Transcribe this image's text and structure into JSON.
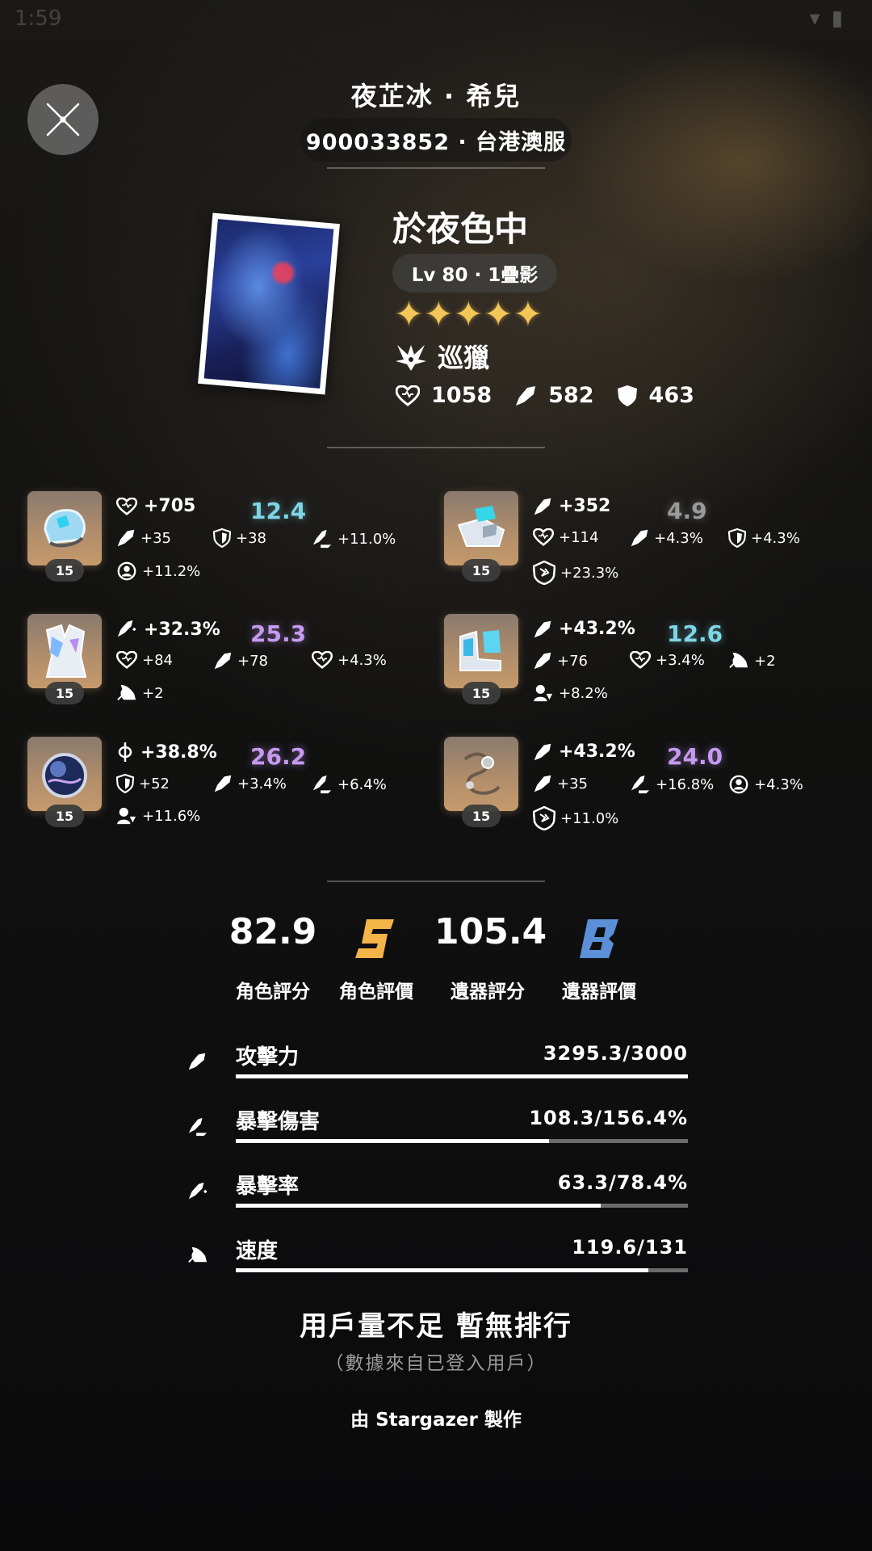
{
  "status_bar": {
    "time": "1:59"
  },
  "header": {
    "player_name": "夜芷冰 · 希兒",
    "uid_server": "900033852 · 台港澳服"
  },
  "light_cone": {
    "name": "於夜色中",
    "level": "Lv 80 · 1疊影",
    "stars": "✦✦✦✦✦",
    "rarity": 5,
    "path": "巡獵",
    "hp": "1058",
    "atk": "582",
    "def": "463"
  },
  "relics": [
    {
      "slot": "head",
      "level": "15",
      "main": {
        "icon": "hp-icon",
        "value": "+705"
      },
      "score": "12.4",
      "score_color": "#7fd6e6",
      "subs": [
        {
          "icon": "atk-icon",
          "value": "+35"
        },
        {
          "icon": "def-icon",
          "value": "+38"
        },
        {
          "icon": "crit-dmg-icon",
          "value": "+11.0%"
        },
        {
          "icon": "effect-res-icon",
          "value": "+11.2%"
        }
      ]
    },
    {
      "slot": "hands",
      "level": "15",
      "main": {
        "icon": "atk-icon",
        "value": "+352"
      },
      "score": "4.9",
      "score_color": "#9a9a9a",
      "subs": [
        {
          "icon": "hp-icon",
          "value": "+114"
        },
        {
          "icon": "atk-icon",
          "value": "+4.3%"
        },
        {
          "icon": "def-icon",
          "value": "+4.3%"
        },
        {
          "icon": "break-effect-icon",
          "value": "+23.3%"
        }
      ]
    },
    {
      "slot": "body",
      "level": "15",
      "main": {
        "icon": "crit-rate-icon",
        "value": "+32.3%"
      },
      "score": "25.3",
      "score_color": "#c59af0",
      "subs": [
        {
          "icon": "hp-icon",
          "value": "+84"
        },
        {
          "icon": "atk-icon",
          "value": "+78"
        },
        {
          "icon": "hp-icon",
          "value": "+4.3%"
        },
        {
          "icon": "speed-icon",
          "value": "+2"
        }
      ]
    },
    {
      "slot": "feet",
      "level": "15",
      "main": {
        "icon": "atk-icon",
        "value": "+43.2%"
      },
      "score": "12.6",
      "score_color": "#7fd6e6",
      "subs": [
        {
          "icon": "atk-icon",
          "value": "+76"
        },
        {
          "icon": "hp-icon",
          "value": "+3.4%"
        },
        {
          "icon": "speed-icon",
          "value": "+2"
        },
        {
          "icon": "effect-hit-icon",
          "value": "+8.2%"
        }
      ]
    },
    {
      "slot": "sphere",
      "level": "15",
      "main": {
        "icon": "quantum-dmg-icon",
        "value": "+38.8%"
      },
      "score": "26.2",
      "score_color": "#c59af0",
      "subs": [
        {
          "icon": "def-icon",
          "value": "+52"
        },
        {
          "icon": "atk-icon",
          "value": "+3.4%"
        },
        {
          "icon": "crit-dmg-icon",
          "value": "+6.4%"
        },
        {
          "icon": "effect-hit-icon",
          "value": "+11.6%"
        }
      ]
    },
    {
      "slot": "rope",
      "level": "15",
      "main": {
        "icon": "atk-icon",
        "value": "+43.2%"
      },
      "score": "24.0",
      "score_color": "#c59af0",
      "subs": [
        {
          "icon": "atk-icon",
          "value": "+35"
        },
        {
          "icon": "crit-dmg-icon",
          "value": "+16.8%"
        },
        {
          "icon": "effect-res-icon",
          "value": "+4.3%"
        },
        {
          "icon": "break-effect-icon",
          "value": "+11.0%"
        }
      ]
    }
  ],
  "scores": {
    "character_score": "82.9",
    "character_score_label": "角色評分",
    "character_grade": "S",
    "character_grade_color": "#f3b548",
    "character_grade_label": "角色評價",
    "relic_score": "105.4",
    "relic_score_label": "遺器評分",
    "relic_grade": "B",
    "relic_grade_color": "#5b8fd6",
    "relic_grade_label": "遺器評價"
  },
  "stats": [
    {
      "icon": "atk-icon",
      "label": "攻擊力",
      "value": "3295.3/3000",
      "fill": 1.0
    },
    {
      "icon": "crit-dmg-icon",
      "label": "暴擊傷害",
      "value": "108.3/156.4%",
      "fill": 0.692
    },
    {
      "icon": "crit-rate-icon",
      "label": "暴擊率",
      "value": "63.3/78.4%",
      "fill": 0.807
    },
    {
      "icon": "speed-icon",
      "label": "速度",
      "value": "119.6/131",
      "fill": 0.913
    }
  ],
  "ranking": {
    "message": "用戶量不足 暫無排行",
    "note": "（數據來自已登入用戶）"
  },
  "credit": "由 Stargazer 製作"
}
